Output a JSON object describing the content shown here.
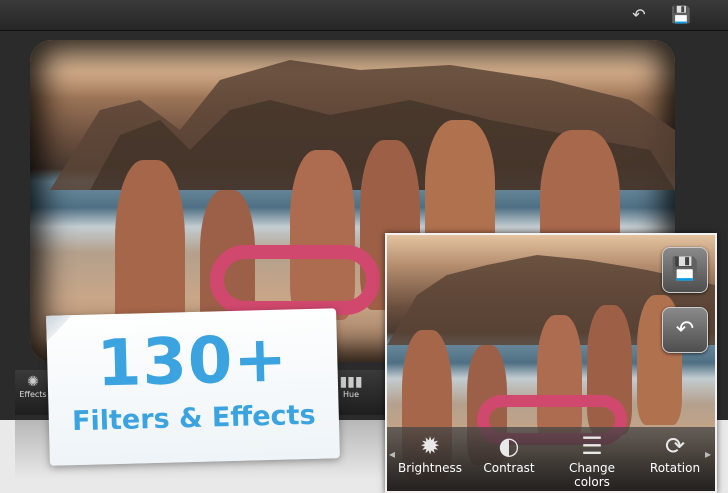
{
  "topbar": {
    "undo_icon": "undo-arrow-icon",
    "save_icon": "floppy-save-icon",
    "undo_glyph": "↶",
    "save_glyph": "💾"
  },
  "toolbar": {
    "items": [
      {
        "label": "Effects",
        "icon": "effects-icon",
        "glyph": "✺"
      },
      {
        "label": "Hue",
        "icon": "hue-icon",
        "glyph": "▮▮▮"
      }
    ]
  },
  "promo": {
    "headline": "130+",
    "subline": "Filters & Effects",
    "color": "#3aa3e0"
  },
  "inset": {
    "save_glyph": "💾",
    "undo_glyph": "↶",
    "tools": [
      {
        "label": "Brightness",
        "icon": "brightness-sun-icon",
        "glyph": "✹"
      },
      {
        "label": "Contrast",
        "icon": "contrast-circle-icon",
        "glyph": "◐"
      },
      {
        "label": "Change colors",
        "icon": "sliders-icon",
        "glyph": "☰"
      },
      {
        "label": "Rotation",
        "icon": "rotate-icon",
        "glyph": "⟳"
      }
    ],
    "left_arrow": "◂",
    "right_arrow": "▸"
  }
}
